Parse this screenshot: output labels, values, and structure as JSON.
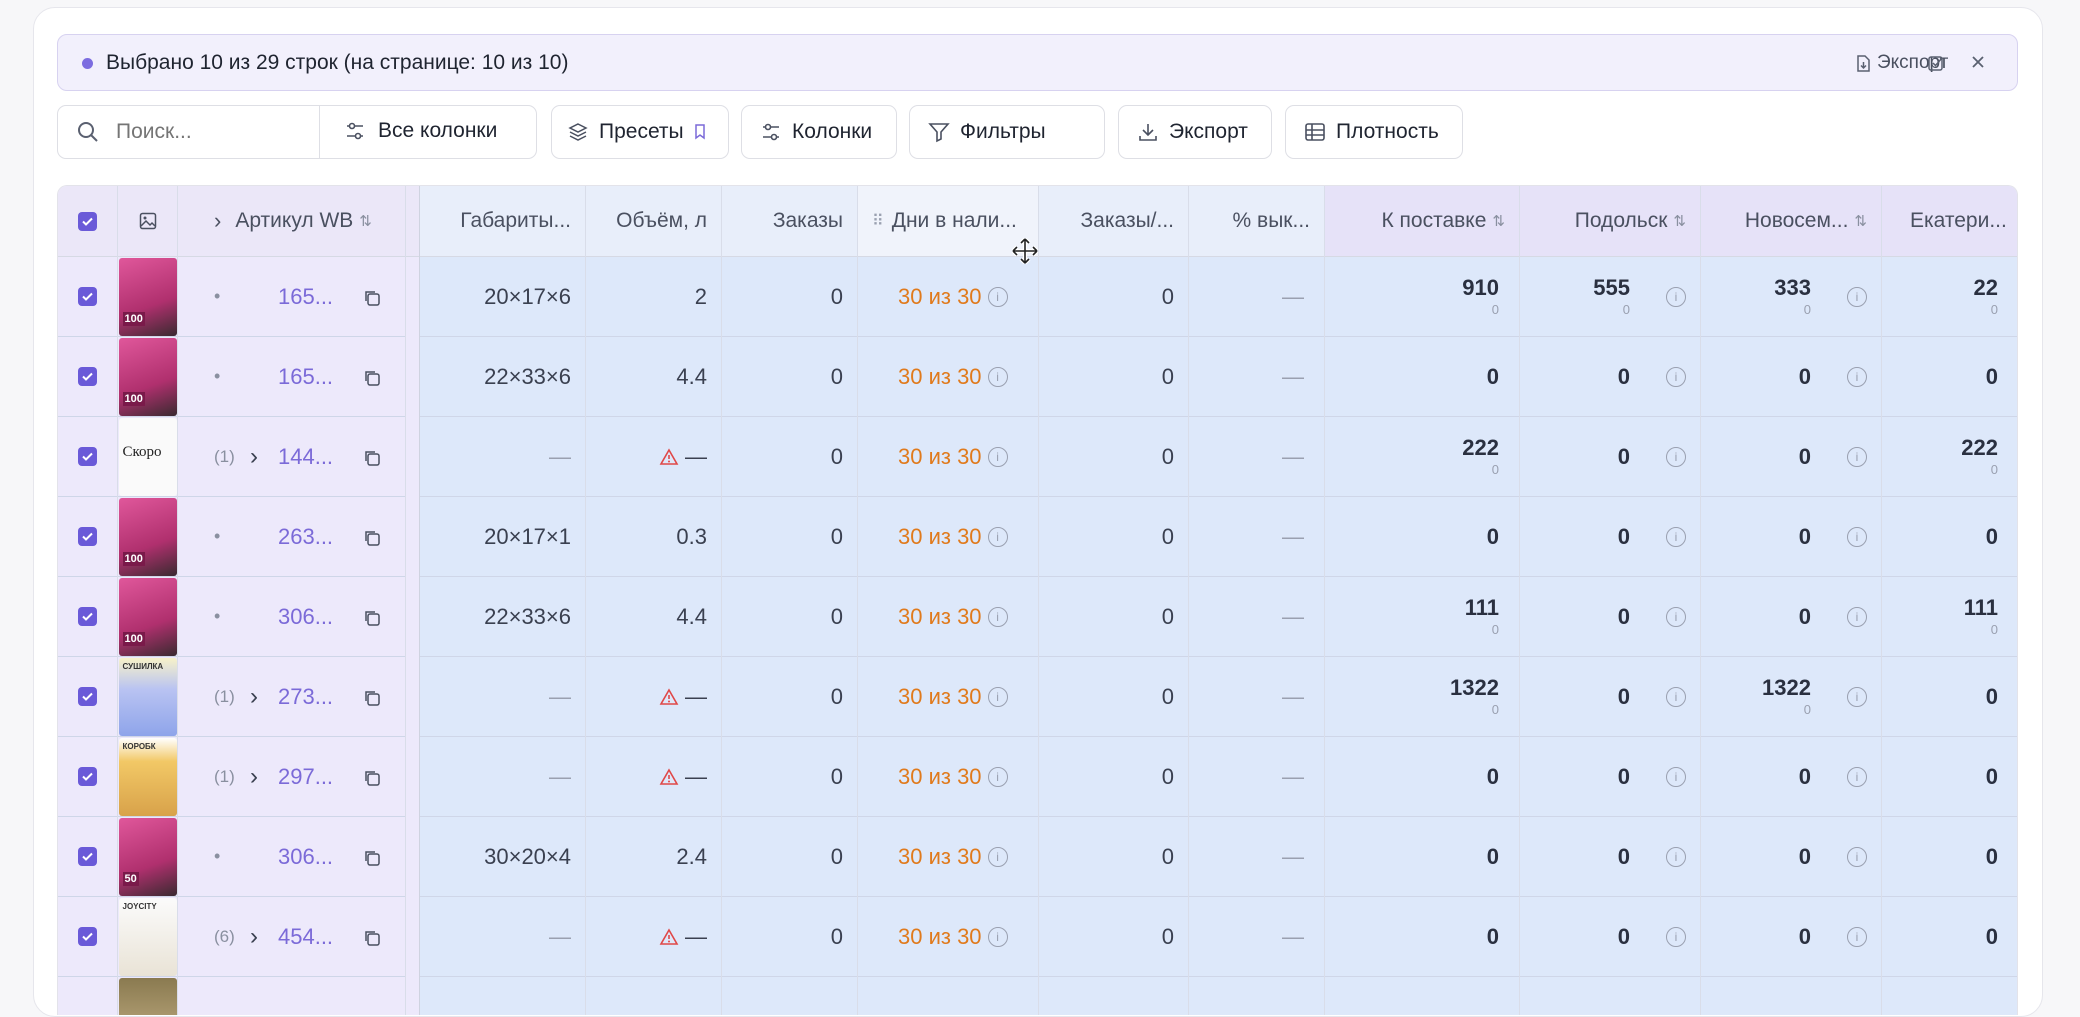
{
  "selection_bar": {
    "message": "Выбрано 10 из 29 строк (на странице: 10 из 10)",
    "export_label": "Экспорт"
  },
  "toolbar": {
    "search_placeholder": "Поиск...",
    "all_columns_label": "Все колонки",
    "presets_label": "Пресеты",
    "columns_label": "Колонки",
    "filters_label": "Фильтры",
    "export_label": "Экспорт",
    "density_label": "Плотность"
  },
  "columns": {
    "article": "Артикул WB",
    "dims": "Габариты...",
    "volume": "Объём, л",
    "orders": "Заказы",
    "days": "Дни в нали...",
    "orders_per": "Заказы/...",
    "buyout": "% вык...",
    "to_supply": "К поставке",
    "podolsk": "Подольск",
    "novosem": "Новосем...",
    "ekater": "Екатери..."
  },
  "rows": [
    {
      "prefix": "•",
      "article": "165...",
      "dims": "20×17×6",
      "volume": "2",
      "vol_warn": false,
      "orders": "0",
      "days": "30 из 30",
      "orders_per": "0",
      "buyout": "—",
      "to_supply": "910",
      "to_supply_sub": "0",
      "podolsk": "555",
      "podolsk_sub": "0",
      "novosem": "333",
      "novosem_sub": "0",
      "ekater": "22",
      "ekater_sub": "0",
      "thumb": "pink",
      "thumb_text": "100"
    },
    {
      "prefix": "•",
      "article": "165...",
      "dims": "22×33×6",
      "volume": "4.4",
      "vol_warn": false,
      "orders": "0",
      "days": "30 из 30",
      "orders_per": "0",
      "buyout": "—",
      "to_supply": "0",
      "to_supply_sub": "",
      "podolsk": "0",
      "podolsk_sub": "",
      "novosem": "0",
      "novosem_sub": "",
      "ekater": "0",
      "ekater_sub": "",
      "thumb": "pink",
      "thumb_text": "100"
    },
    {
      "prefix": "(1)",
      "article": "144...",
      "dims": "—",
      "volume": "—",
      "vol_warn": true,
      "orders": "0",
      "days": "30 из 30",
      "orders_per": "0",
      "buyout": "—",
      "to_supply": "222",
      "to_supply_sub": "0",
      "podolsk": "0",
      "podolsk_sub": "",
      "novosem": "0",
      "novosem_sub": "",
      "ekater": "222",
      "ekater_sub": "0",
      "thumb": "white",
      "thumb_text": "Скоро"
    },
    {
      "prefix": "•",
      "article": "263...",
      "dims": "20×17×1",
      "volume": "0.3",
      "vol_warn": false,
      "orders": "0",
      "days": "30 из 30",
      "orders_per": "0",
      "buyout": "—",
      "to_supply": "0",
      "to_supply_sub": "",
      "podolsk": "0",
      "podolsk_sub": "",
      "novosem": "0",
      "novosem_sub": "",
      "ekater": "0",
      "ekater_sub": "",
      "thumb": "pink",
      "thumb_text": "100"
    },
    {
      "prefix": "•",
      "article": "306...",
      "dims": "22×33×6",
      "volume": "4.4",
      "vol_warn": false,
      "orders": "0",
      "days": "30 из 30",
      "orders_per": "0",
      "buyout": "—",
      "to_supply": "111",
      "to_supply_sub": "0",
      "podolsk": "0",
      "podolsk_sub": "",
      "novosem": "0",
      "novosem_sub": "",
      "ekater": "111",
      "ekater_sub": "0",
      "thumb": "pink",
      "thumb_text": "100"
    },
    {
      "prefix": "(1)",
      "article": "273...",
      "dims": "—",
      "volume": "—",
      "vol_warn": true,
      "orders": "0",
      "days": "30 из 30",
      "orders_per": "0",
      "buyout": "—",
      "to_supply": "1322",
      "to_supply_sub": "0",
      "podolsk": "0",
      "podolsk_sub": "",
      "novosem": "1322",
      "novosem_sub": "0",
      "ekater": "0",
      "ekater_sub": "",
      "thumb": "lilac",
      "thumb_text": "СУШИЛКА"
    },
    {
      "prefix": "(1)",
      "article": "297...",
      "dims": "—",
      "volume": "—",
      "vol_warn": true,
      "orders": "0",
      "days": "30 из 30",
      "orders_per": "0",
      "buyout": "—",
      "to_supply": "0",
      "to_supply_sub": "",
      "podolsk": "0",
      "podolsk_sub": "",
      "novosem": "0",
      "novosem_sub": "",
      "ekater": "0",
      "ekater_sub": "",
      "thumb": "box",
      "thumb_text": "КОРОБК"
    },
    {
      "prefix": "•",
      "article": "306...",
      "dims": "30×20×4",
      "volume": "2.4",
      "vol_warn": false,
      "orders": "0",
      "days": "30 из 30",
      "orders_per": "0",
      "buyout": "—",
      "to_supply": "0",
      "to_supply_sub": "",
      "podolsk": "0",
      "podolsk_sub": "",
      "novosem": "0",
      "novosem_sub": "",
      "ekater": "0",
      "ekater_sub": "",
      "thumb": "pink",
      "thumb_text": "50"
    },
    {
      "prefix": "(6)",
      "article": "454...",
      "dims": "—",
      "volume": "—",
      "vol_warn": true,
      "orders": "0",
      "days": "30 из 30",
      "orders_per": "0",
      "buyout": "—",
      "to_supply": "0",
      "to_supply_sub": "",
      "podolsk": "0",
      "podolsk_sub": "",
      "novosem": "0",
      "novosem_sub": "",
      "ekater": "0",
      "ekater_sub": "",
      "thumb": "shoe",
      "thumb_text": "JOYCITY"
    }
  ]
}
